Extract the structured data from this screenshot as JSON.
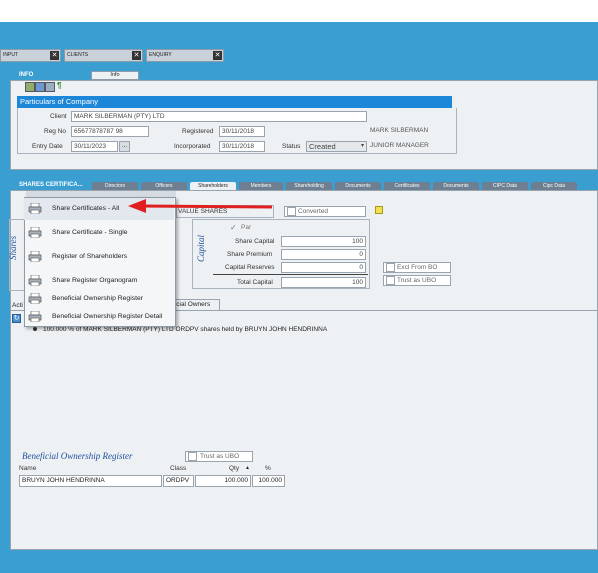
{
  "window_tabs": [
    {
      "label": "INPUT"
    },
    {
      "label": "CLIENTS"
    },
    {
      "label": "ENQUIRY"
    }
  ],
  "info": {
    "title": "INFO",
    "tab_label": "Info",
    "section_title": "Particulars of Company",
    "client_label": "Client",
    "client_value": "MARK SILBERMAN (PTY) LTD",
    "regno_label": "Reg No",
    "regno_value": "65677878787 98",
    "registered_label": "Registered",
    "registered_value": "30/11/2018",
    "entry_date_label": "Entry Date",
    "entry_date_value": "30/11/2023",
    "incorporated_label": "Incorporated",
    "incorporated_value": "30/11/2018",
    "status_label": "Status",
    "status_value": "Created",
    "person_name": "MARK SILBERMAN",
    "person_role": "JUNIOR MANAGER"
  },
  "shares": {
    "title": "SHARES CERTIFICA...",
    "subtabs": [
      "Directors",
      "Officers",
      "Shareholders",
      "Members",
      "Shareholding",
      "Documents",
      "Certificates",
      "Documents",
      "CIPC Data",
      "Cipc Data"
    ],
    "shares_vertical": "Shares",
    "capital_vertical": "Capital",
    "value_shares": "VALUE SHARES",
    "converted_label": "Converted",
    "par_label": "Par",
    "share_capital_label": "Share Capital",
    "share_capital_value": "100",
    "share_premium_label": "Share Premium",
    "share_premium_value": "0",
    "capital_reserves_label": "Capital Reserves",
    "capital_reserves_value": "0",
    "total_capital_label": "Total Capital",
    "total_capital_value": "100",
    "excl_from_bo_label": "Excl From BO",
    "trust_as_ubo_label": "Trust as UBO",
    "bottom_tab_left": "Acti",
    "bottom_tab_right": "ficial Owners",
    "tree_item": "100.000 % of MARK SILBERMAN (PTY) LTD ORDPV shares held by BRUYN JOHN HENDRINNA"
  },
  "dropdown_menu": [
    {
      "label": "Share Certificates - All"
    },
    {
      "label": "Share Certificate - Single"
    },
    {
      "label": "Register of Shareholders"
    },
    {
      "label": "Share Register Organogram"
    },
    {
      "label": "Beneficial Ownership Register"
    },
    {
      "label": "Beneficial Ownership Register Detail"
    }
  ],
  "bo_register": {
    "title": "Beneficial Ownership Register",
    "trust_label": "Trust as UBO",
    "columns": [
      "Name",
      "Class",
      "Qty",
      "%"
    ],
    "rows": [
      {
        "name": "BRUYN JOHN HENDRINNA",
        "class": "ORDPV",
        "qty": "100.000",
        "pct": "100.000"
      }
    ]
  },
  "colors": {
    "app_background": "#3a9fd0",
    "header_bar": "#1c86d8",
    "arrow": "#e02020"
  },
  "icons": [
    "close-icon",
    "printer-icon",
    "refresh-icon",
    "note-icon",
    "triangle-marker-icon"
  ]
}
